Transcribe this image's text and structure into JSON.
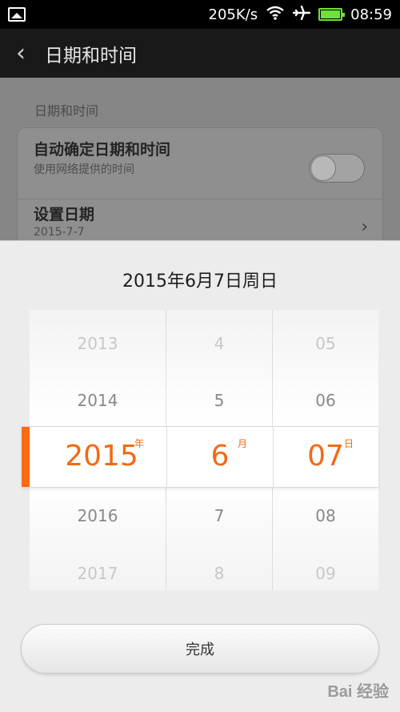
{
  "status_bar": {
    "speed": "205K/s",
    "time": "08:59",
    "battery_percent": 100
  },
  "header": {
    "title": "日期和时间"
  },
  "settings": {
    "section_label": "日期和时间",
    "auto_time": {
      "title": "自动确定日期和时间",
      "subtitle": "使用网络提供的时间",
      "enabled": false
    },
    "set_date": {
      "title": "设置日期",
      "value": "2015-7-7"
    }
  },
  "date_picker": {
    "title": "2015年6月7日周日",
    "year": {
      "items": [
        "2013",
        "2014",
        "2015",
        "2016",
        "2017"
      ],
      "selected": "2015",
      "unit": "年"
    },
    "month": {
      "items": [
        "4",
        "5",
        "6",
        "7",
        "8"
      ],
      "selected": "6",
      "unit": "月"
    },
    "day": {
      "items": [
        "05",
        "06",
        "07",
        "08",
        "09"
      ],
      "selected": "07",
      "unit": "日"
    },
    "done_label": "完成"
  },
  "watermark": "Bai 经验",
  "colors": {
    "accent": "#f26a14",
    "battery": "#6fe23a"
  }
}
